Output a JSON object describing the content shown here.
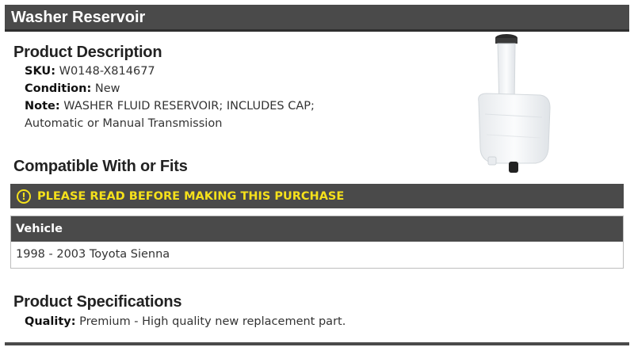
{
  "title": "Washer Reservoir",
  "product_description": {
    "heading": "Product Description",
    "sku_label": "SKU:",
    "sku_value": "W0148-X814677",
    "condition_label": "Condition:",
    "condition_value": "New",
    "note_label": "Note:",
    "note_value_line1": "WASHER FLUID RESERVOIR; INCLUDES CAP;",
    "note_value_line2": "Automatic or Manual Transmission"
  },
  "compatibility": {
    "heading": "Compatible With or Fits",
    "warning_icon": "exclamation-circle-icon",
    "warning_icon_glyph": "!",
    "warning_text": "PLEASE READ BEFORE MAKING THIS PURCHASE",
    "table": {
      "column_header": "Vehicle",
      "rows": [
        "1998 - 2003 Toyota Sienna"
      ]
    }
  },
  "specifications": {
    "heading": "Product Specifications",
    "quality_label": "Quality:",
    "quality_value": "Premium - High quality new replacement part."
  },
  "colors": {
    "header_bg": "#4a4a4a",
    "warning_text": "#f5e11b",
    "text": "#333333"
  }
}
